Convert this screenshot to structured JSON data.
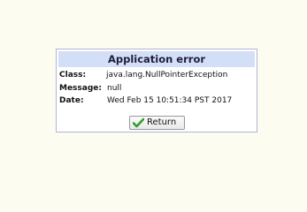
{
  "dialog": {
    "title": "Application error",
    "fields": [
      {
        "label": "Class:",
        "value": "java.lang.NullPointerException"
      },
      {
        "label": "Message:",
        "value": "null"
      },
      {
        "label": "Date:",
        "value": "Wed Feb 15 10:51:34 PST 2017"
      }
    ],
    "return_label": "Return",
    "return_icon": "checkmark-icon"
  },
  "colors": {
    "background": "#fcfcf1",
    "title_bar": "#d3def7",
    "border": "#b0b4d4",
    "check": "#2e9e2e"
  }
}
